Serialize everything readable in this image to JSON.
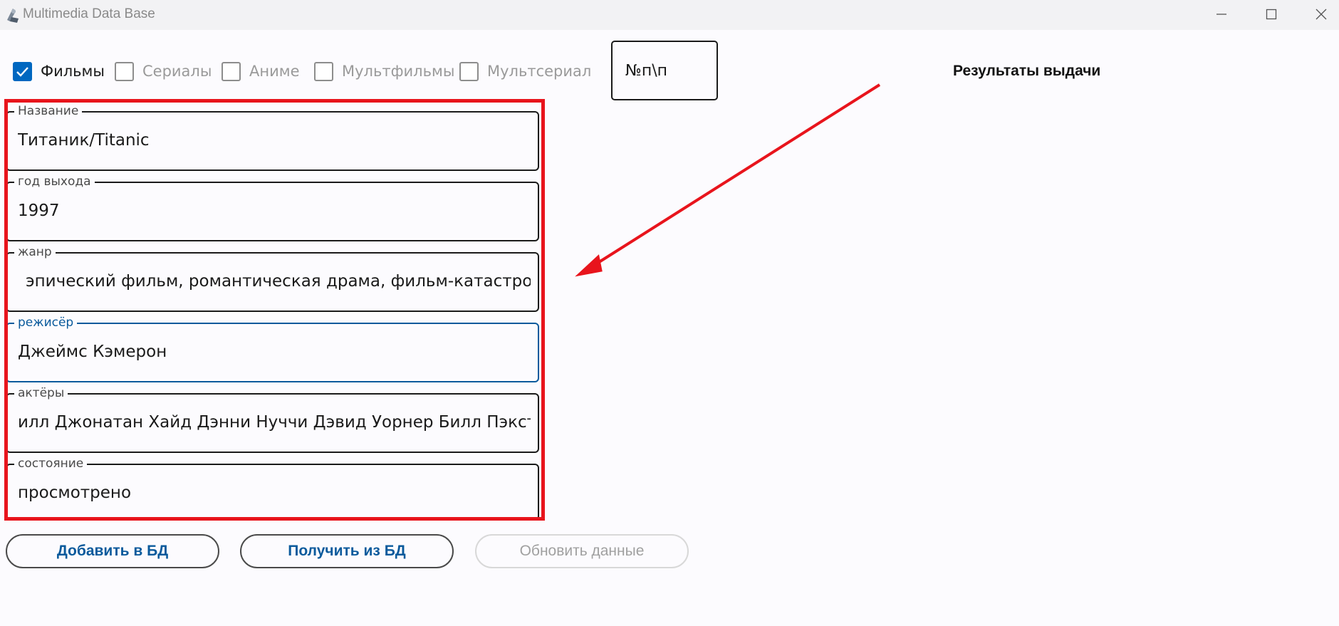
{
  "window": {
    "title": "Multimedia Data Base"
  },
  "filters": [
    {
      "label": "Фильмы",
      "checked": true
    },
    {
      "label": "Сериалы",
      "checked": false
    },
    {
      "label": "Аниме",
      "checked": false
    },
    {
      "label": "Мультфильмы",
      "checked": false
    },
    {
      "label": "Мультсериал",
      "checked": false
    }
  ],
  "index_box": {
    "value": "№п\\п"
  },
  "results": {
    "title": "Результаты выдачи"
  },
  "form": {
    "title": {
      "label": "Название",
      "value": "Титаник/Titanic"
    },
    "year": {
      "label": "год выхода",
      "value": "1997"
    },
    "genre": {
      "label": "жанр",
      "value": "эпический фильм, романтическая драма, фильм-катастрофа"
    },
    "director": {
      "label": "режисёр",
      "value": "Джеймс Кэмерон"
    },
    "actors": {
      "label": "актёры",
      "value": "илл Джонатан Хайд Дэнни Нуччи Дэвид Уорнер Билл Пэкстон"
    },
    "status": {
      "label": "состояние",
      "value": "просмотрено"
    }
  },
  "buttons": {
    "add": "Добавить в БД",
    "get": "Получить из БД",
    "update": "Обновить данные"
  },
  "colors": {
    "accent": "#0067c0",
    "annotation": "#e8141c",
    "focused_border": "#0a5a9c"
  }
}
